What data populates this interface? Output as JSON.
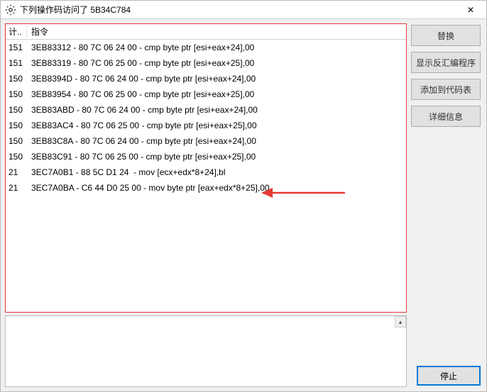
{
  "title": "下列操作码访问了 5B34C784",
  "close_glyph": "✕",
  "columns": {
    "count": "计..",
    "instr": "指令"
  },
  "rows": [
    {
      "count": "151",
      "instr": "3EB83312 - 80 7C 06 24 00 - cmp byte ptr [esi+eax+24],00"
    },
    {
      "count": "151",
      "instr": "3EB83319 - 80 7C 06 25 00 - cmp byte ptr [esi+eax+25],00"
    },
    {
      "count": "150",
      "instr": "3EB8394D - 80 7C 06 24 00 - cmp byte ptr [esi+eax+24],00"
    },
    {
      "count": "150",
      "instr": "3EB83954 - 80 7C 06 25 00 - cmp byte ptr [esi+eax+25],00"
    },
    {
      "count": "150",
      "instr": "3EB83ABD - 80 7C 06 24 00 - cmp byte ptr [esi+eax+24],00"
    },
    {
      "count": "150",
      "instr": "3EB83AC4 - 80 7C 06 25 00 - cmp byte ptr [esi+eax+25],00"
    },
    {
      "count": "150",
      "instr": "3EB83C8A - 80 7C 06 24 00 - cmp byte ptr [esi+eax+24],00"
    },
    {
      "count": "150",
      "instr": "3EB83C91 - 80 7C 06 25 00 - cmp byte ptr [esi+eax+25],00"
    },
    {
      "count": "21",
      "instr": "3EC7A0B1 - 88 5C D1 24  - mov [ecx+edx*8+24],bl"
    },
    {
      "count": "21",
      "instr": "3EC7A0BA - C6 44 D0 25 00 - mov byte ptr [eax+edx*8+25],00"
    }
  ],
  "buttons": {
    "replace": "替换",
    "show_disasm": "显示反汇编程序",
    "add_to_codelist": "添加到代码表",
    "details": "详细信息",
    "stop": "停止"
  },
  "scroll_up_glyph": "▴",
  "arrow_color": "#e53935"
}
